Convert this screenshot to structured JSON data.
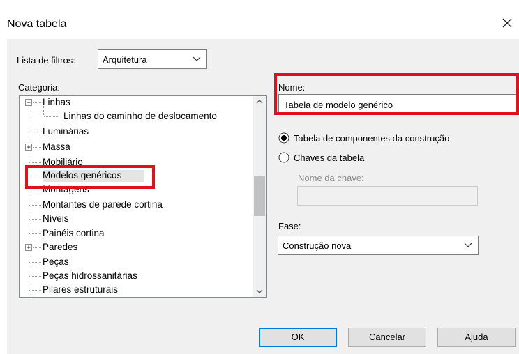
{
  "dialog": {
    "title": "Nova tabela"
  },
  "filter": {
    "label": "Lista de filtros:",
    "value": "Arquitetura"
  },
  "category": {
    "label": "Categoria:",
    "items": [
      {
        "label": "Linhas",
        "expander": "minus"
      },
      {
        "label": "Linhas do caminho de deslocamento"
      },
      {
        "label": "Luminárias"
      },
      {
        "label": "Massa",
        "expander": "plus"
      },
      {
        "label": "Mobiliário"
      },
      {
        "label": "Modelos genéricos",
        "selected": true
      },
      {
        "label": "Montagens"
      },
      {
        "label": "Montantes de parede cortina"
      },
      {
        "label": "Níveis"
      },
      {
        "label": "Painéis cortina"
      },
      {
        "label": "Paredes",
        "expander": "plus"
      },
      {
        "label": "Peças"
      },
      {
        "label": "Peças hidrossanitárias"
      },
      {
        "label": "Pilares estruturais"
      }
    ]
  },
  "name": {
    "label": "Nome:",
    "value": "Tabela de modelo genérico"
  },
  "options": {
    "building_components": "Tabela de componentes da construção",
    "schedule_keys": "Chaves da tabela",
    "selected": "building_components",
    "key_name_label": "Nome da chave:",
    "key_name_value": ""
  },
  "phase": {
    "label": "Fase:",
    "value": "Construção nova"
  },
  "buttons": {
    "ok": "OK",
    "cancel": "Cancelar",
    "help": "Ajuda"
  },
  "colors": {
    "highlight": "#e0101e",
    "default_button_border": "#0078d7"
  }
}
